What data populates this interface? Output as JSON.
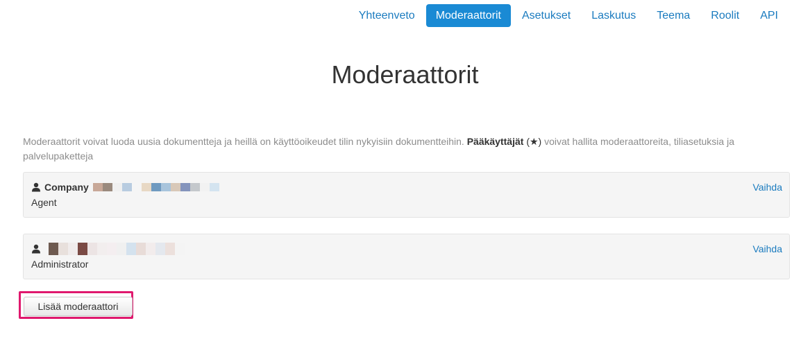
{
  "nav": {
    "items": [
      {
        "label": "Yhteenveto",
        "active": false
      },
      {
        "label": "Moderaattorit",
        "active": true
      },
      {
        "label": "Asetukset",
        "active": false
      },
      {
        "label": "Laskutus",
        "active": false
      },
      {
        "label": "Teema",
        "active": false
      },
      {
        "label": "Roolit",
        "active": false
      },
      {
        "label": "API",
        "active": false
      }
    ]
  },
  "page": {
    "title": "Moderaattorit",
    "description_part1": "Moderaattorit voivat luoda uusia dokumentteja ja heillä on käyttöoikeudet tilin nykyisiin dokumentteihin. ",
    "description_bold": "Pääkäyttäjät",
    "description_star": "(★)",
    "description_part2": " voivat hallita moderaattoreita, tiliasetuksia ja palvelupaketteja"
  },
  "moderators": [
    {
      "name": "Company",
      "role": "Agent",
      "action_label": "Vaihda"
    },
    {
      "name": "",
      "role": "Administrator",
      "action_label": "Vaihda"
    }
  ],
  "actions": {
    "add_moderator_label": "Lisää moderaattori"
  },
  "colors": {
    "accent": "#1a8ad4",
    "link": "#1a7bbf",
    "highlight": "#e0196e"
  },
  "icons": {
    "user": "user-icon"
  }
}
